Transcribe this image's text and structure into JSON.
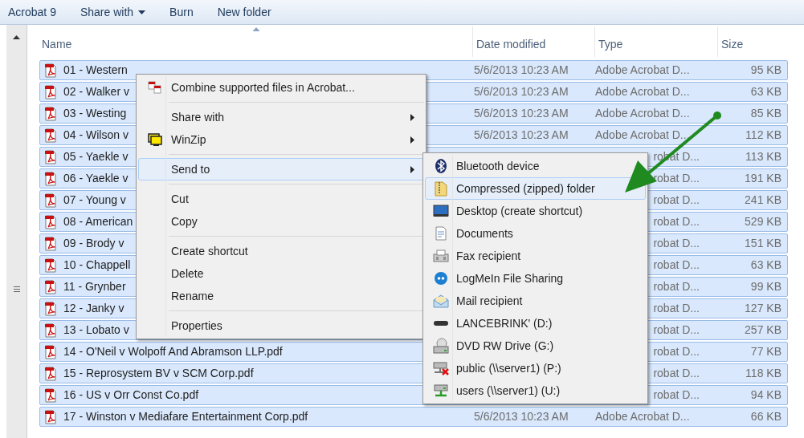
{
  "toolbar": [
    {
      "label": "Acrobat 9",
      "dropdown": false
    },
    {
      "label": "Share with",
      "dropdown": true
    },
    {
      "label": "Burn",
      "dropdown": false
    },
    {
      "label": "New folder",
      "dropdown": false
    }
  ],
  "columns": [
    {
      "label": "Name",
      "sorted": true
    },
    {
      "label": "Date modified",
      "sorted": false
    },
    {
      "label": "Type",
      "sorted": false
    },
    {
      "label": "Size",
      "sorted": false
    }
  ],
  "rows": [
    {
      "name": "01 - Western",
      "date": "5/6/2013 10:23 AM",
      "type": "Adobe Acrobat D...",
      "size": "95 KB",
      "selected": true
    },
    {
      "name": "02 - Walker v",
      "date": "5/6/2013 10:23 AM",
      "type": "Adobe Acrobat D...",
      "size": "63 KB",
      "selected": true
    },
    {
      "name": "03 - Westing",
      "date": "5/6/2013 10:23 AM",
      "type": "Adobe Acrobat D...",
      "size": "85 KB",
      "selected": true
    },
    {
      "name": "04 - Wilson v",
      "date": "5/6/2013 10:23 AM",
      "type": "Adobe Acrobat D...",
      "size": "112 KB",
      "selected": true
    },
    {
      "name": "05 - Yaekle v",
      "type": "robat D...",
      "size": "113 KB",
      "selected": true
    },
    {
      "name": "06 - Yaekle v",
      "type": "robat D...",
      "size": "191 KB",
      "selected": true
    },
    {
      "name": "07 - Young v",
      "type": "robat D...",
      "size": "241 KB",
      "selected": true
    },
    {
      "name": "08 - American",
      "type": "robat D...",
      "size": "529 KB",
      "selected": true
    },
    {
      "name": "09 - Brody v",
      "type": "robat D...",
      "size": "151 KB",
      "selected": true
    },
    {
      "name": "10 - Chappell",
      "type": "robat D...",
      "size": "63 KB",
      "selected": true
    },
    {
      "name": "11 - Grynber",
      "type": "robat D...",
      "size": "99 KB",
      "selected": true
    },
    {
      "name": "12 - Janky v",
      "type": "robat D...",
      "size": "127 KB",
      "selected": true
    },
    {
      "name": "13 - Lobato v",
      "type": "robat D...",
      "size": "257 KB",
      "selected": true
    },
    {
      "name": "14 - O'Neil v Wolpoff And Abramson LLP.pdf",
      "type": "robat D...",
      "size": "77 KB",
      "selected": true
    },
    {
      "name": "15 - Reprosystem BV v SCM Corp.pdf",
      "type": "robat D...",
      "size": "118 KB",
      "selected": true
    },
    {
      "name": "16 - US v Orr Const Co.pdf",
      "type": "robat D...",
      "size": "94 KB",
      "selected": true
    },
    {
      "name": "17 - Winston v Mediafare Entertainment Corp.pdf",
      "date": "5/6/2013 10:23 AM",
      "type": "Adobe Acrobat D...",
      "size": "66 KB",
      "selected": true
    }
  ],
  "context_menu": {
    "items": [
      {
        "kind": "item",
        "label": "Combine supported files in Acrobat...",
        "submenu": false,
        "selected": false
      },
      {
        "kind": "separator"
      },
      {
        "kind": "item",
        "label": "Share with",
        "submenu": true,
        "selected": false
      },
      {
        "kind": "item",
        "label": "WinZip",
        "submenu": true,
        "selected": false
      },
      {
        "kind": "separator"
      },
      {
        "kind": "item",
        "label": "Send to",
        "submenu": true,
        "selected": true
      },
      {
        "kind": "separator"
      },
      {
        "kind": "item",
        "label": "Cut",
        "submenu": false,
        "selected": false
      },
      {
        "kind": "item",
        "label": "Copy",
        "submenu": false,
        "selected": false
      },
      {
        "kind": "separator"
      },
      {
        "kind": "item",
        "label": "Create shortcut",
        "submenu": false,
        "selected": false
      },
      {
        "kind": "item",
        "label": "Delete",
        "submenu": false,
        "selected": false
      },
      {
        "kind": "item",
        "label": "Rename",
        "submenu": false,
        "selected": false
      },
      {
        "kind": "separator"
      },
      {
        "kind": "item",
        "label": "Properties",
        "submenu": false,
        "selected": false
      }
    ]
  },
  "send_to_menu": {
    "items": [
      {
        "label": "Bluetooth device",
        "selected": false
      },
      {
        "label": "Compressed (zipped) folder",
        "selected": true
      },
      {
        "label": "Desktop (create shortcut)",
        "selected": false
      },
      {
        "label": "Documents",
        "selected": false
      },
      {
        "label": "Fax recipient",
        "selected": false
      },
      {
        "label": "LogMeIn File Sharing",
        "selected": false
      },
      {
        "label": "Mail recipient",
        "selected": false
      },
      {
        "label": "LANCEBRINK' (D:)",
        "selected": false
      },
      {
        "label": "DVD RW Drive (G:)",
        "selected": false
      },
      {
        "label": "public (\\\\server1) (P:)",
        "selected": false
      },
      {
        "label": "users (\\\\server1) (U:)",
        "selected": false
      }
    ]
  }
}
